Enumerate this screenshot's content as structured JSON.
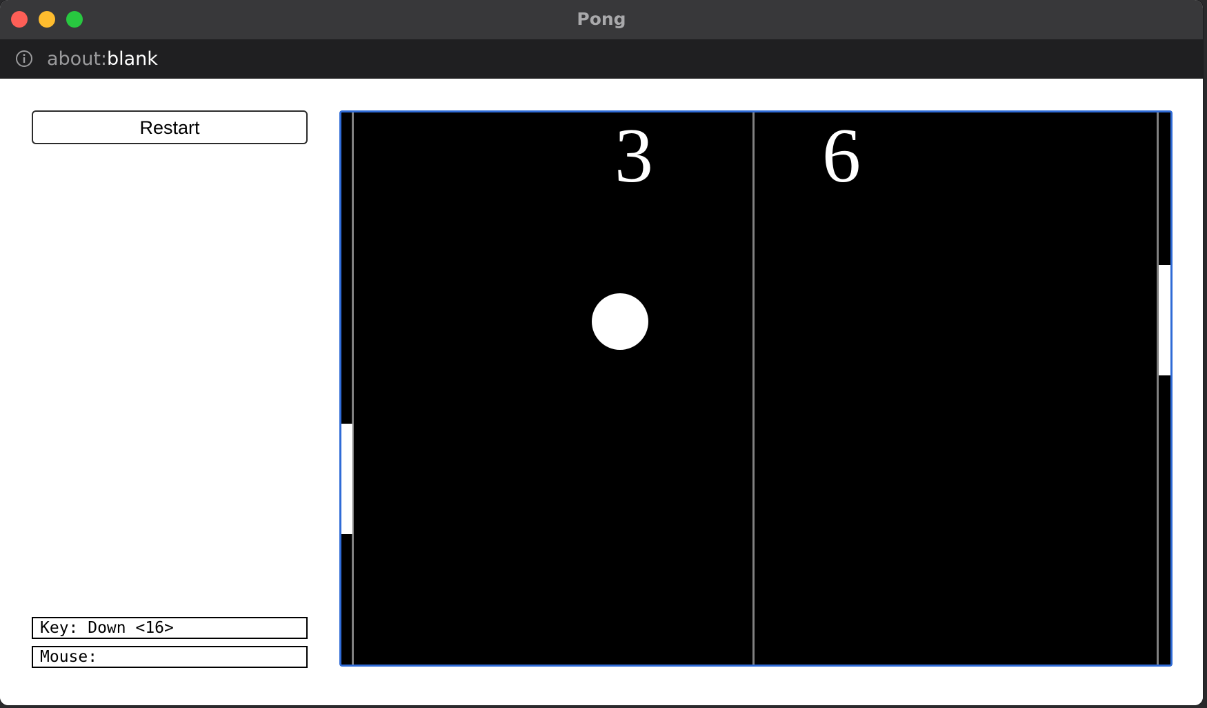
{
  "window": {
    "title": "Pong"
  },
  "address_bar": {
    "url_scheme": "about:",
    "url_path": "blank"
  },
  "controls": {
    "restart_label": "Restart"
  },
  "status": {
    "key_text": "Key: Down <16>",
    "mouse_text": "Mouse:"
  },
  "game": {
    "score_left": "3",
    "score_right": "6",
    "colors": {
      "field": "#000000",
      "lines": "#808080",
      "pieces": "#ffffff",
      "frame_border": "#2f6bd6"
    }
  }
}
